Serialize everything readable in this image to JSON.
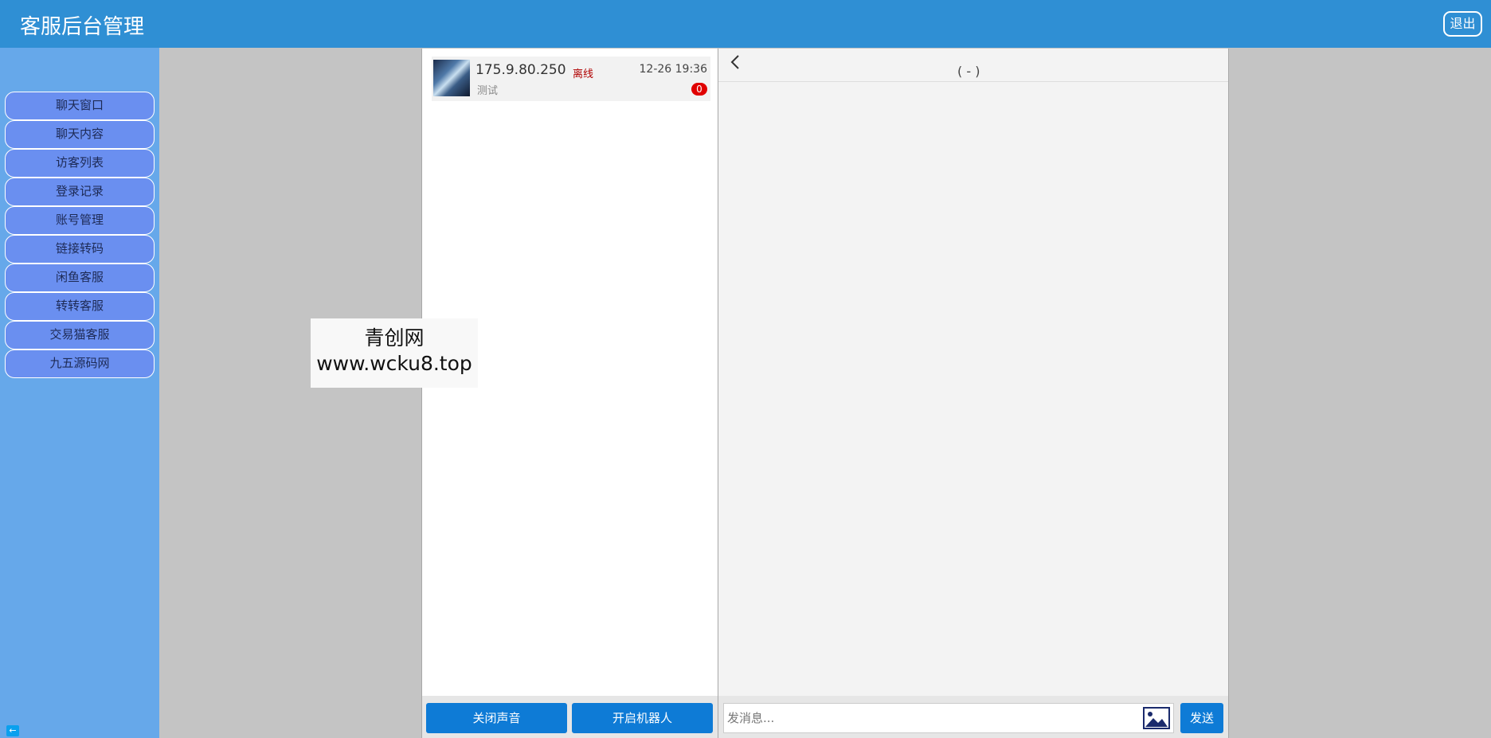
{
  "header": {
    "title": "客服后台管理",
    "logout_label": "退出"
  },
  "sidebar": {
    "items": [
      {
        "label": "聊天窗口"
      },
      {
        "label": "聊天内容"
      },
      {
        "label": "访客列表"
      },
      {
        "label": "登录记录"
      },
      {
        "label": "账号管理"
      },
      {
        "label": "链接转码"
      },
      {
        "label": "闲鱼客服"
      },
      {
        "label": "转转客服"
      },
      {
        "label": "交易猫客服"
      },
      {
        "label": "九五源码网"
      }
    ],
    "collapse_icon": "arrow-left-icon"
  },
  "conversation_list": {
    "items": [
      {
        "ip": "175.9.80.250",
        "status": "离线",
        "time": "12-26 19:36",
        "last_message": "测试",
        "unread": "0"
      }
    ],
    "mute_label": "关闭声音",
    "robot_label": "开启机器人"
  },
  "chat": {
    "title": "( - )",
    "back_icon": "chevron-left-icon",
    "input_placeholder": "发消息...",
    "image_icon": "image-icon",
    "send_label": "发送"
  },
  "watermark": {
    "line1": "青创网",
    "line2": "www.wcku8.top"
  },
  "colors": {
    "header": "#2f8fd4",
    "sidebar": "#66a8ea",
    "nav_item": "#6a8ff0",
    "button": "#0e7bd6",
    "badge": "#e00000",
    "offline": "#b00000"
  }
}
